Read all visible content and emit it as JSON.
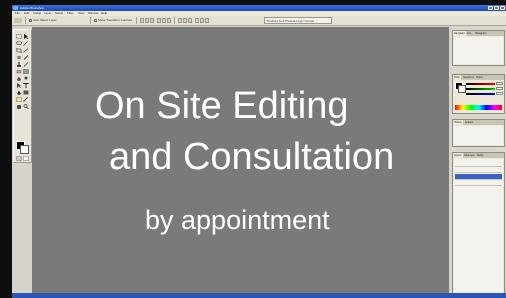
{
  "window": {
    "title": "Adobe Photoshop"
  },
  "menu": [
    "File",
    "Edit",
    "Image",
    "Layer",
    "Select",
    "Filter",
    "View",
    "Window",
    "Help"
  ],
  "options_bar": {
    "checkbox1_label": "Auto Select Layer",
    "checkbox2_label": "Show Transform Controls",
    "palette_well_label": "Brushes  Tool Presets  Layer Comps"
  },
  "canvas": {
    "headline_line1": "On Site Editing",
    "headline_line2": "and Consultation",
    "tagline": "by appointment"
  },
  "panels": {
    "navigator_tabs": [
      "Navigator",
      "Info",
      "Histogram"
    ],
    "color_tabs": [
      "Color",
      "Swatches",
      "Styles"
    ],
    "history_tabs": [
      "History",
      "Actions"
    ],
    "layers_tabs": [
      "Layers",
      "Channels",
      "Paths"
    ]
  },
  "colors": {
    "canvas_bg": "#7a7a7a",
    "canvas_text": "#ffffff",
    "title_bar": "#1a4ab8",
    "chrome": "#ece9d8"
  }
}
